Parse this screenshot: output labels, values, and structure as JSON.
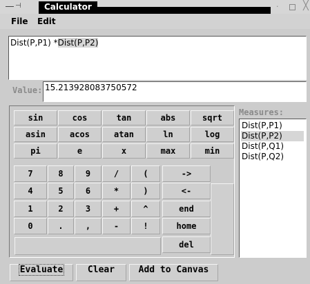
{
  "window": {
    "title": "Calculator",
    "pin_glyph": "⊣",
    "dot_glyph": "·",
    "close_glyph": "╳"
  },
  "menu": {
    "file": "File",
    "edit": "Edit"
  },
  "expression": {
    "before": "Dist(P,P1) *",
    "selected": "Dist(P,P2)"
  },
  "value": {
    "label": "Value:",
    "text": "15.213928083750572"
  },
  "function_keys": [
    [
      "sin",
      "cos",
      "tan",
      "abs",
      "sqrt"
    ],
    [
      "asin",
      "acos",
      "atan",
      "ln",
      "log"
    ],
    [
      "pi",
      "e",
      "x",
      "max",
      "min"
    ]
  ],
  "number_keys": [
    [
      "7",
      "8",
      "9",
      "/",
      "("
    ],
    [
      "4",
      "5",
      "6",
      "*",
      ")"
    ],
    [
      "1",
      "2",
      "3",
      "+",
      "^"
    ],
    [
      "0",
      ".",
      ",",
      "-",
      "!"
    ]
  ],
  "edit_keys": [
    "->",
    "<-",
    "end",
    "home",
    "del"
  ],
  "measures": {
    "label": "Measures:",
    "items": [
      "Dist(P,P1)",
      "Dist(P,P2)",
      "Dist(P,Q1)",
      "Dist(P,Q2)"
    ],
    "selected_index": 1
  },
  "actions": {
    "evaluate": "Evaluate",
    "clear": "Clear",
    "add_to_canvas": "Add to Canvas"
  },
  "colors": {
    "background": "#cccccc",
    "titlebar_active": "#000000",
    "selection": "#d6d6d6"
  }
}
